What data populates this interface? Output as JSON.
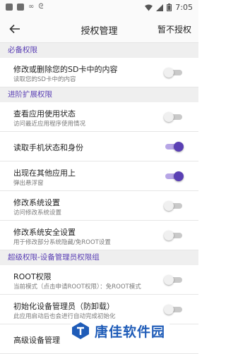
{
  "status_bar": {
    "time": "7:05"
  },
  "app_bar": {
    "title": "授权管理",
    "action_label": "暂不授权"
  },
  "sections": [
    {
      "header": "必备权限",
      "items": [
        {
          "title": "修改或删除您的SD卡中的内容",
          "subtitle": "读取您的SD卡中的内容",
          "enabled": false
        }
      ]
    },
    {
      "header": "进阶扩展权限",
      "items": [
        {
          "title": "查看应用使用状态",
          "subtitle": "访问最近应用程序使用情况",
          "enabled": false
        },
        {
          "title": "读取手机状态和身份",
          "subtitle": "",
          "enabled": true
        },
        {
          "title": "出现在其他应用上",
          "subtitle": "弹出悬浮窗",
          "enabled": true
        },
        {
          "title": "修改系统设置",
          "subtitle": "访问修改系统设置",
          "enabled": false
        },
        {
          "title": "修改系统安全设置",
          "subtitle": "用于修改部分系统隐藏/免ROOT设置",
          "enabled": false
        }
      ]
    },
    {
      "header": "超级权限-设备管理员权限组",
      "items": [
        {
          "title": "ROOT权限",
          "subtitle": "当前模式（点击申请ROOT权限）：免ROOT模式",
          "enabled": false
        },
        {
          "title": "初始化设备管理员（防卸载）",
          "subtitle": "此应用启动后也会进行自动完成初始化",
          "enabled": false
        },
        {
          "title": "高级设备管理",
          "subtitle": "",
          "enabled": false
        }
      ]
    }
  ],
  "watermark": {
    "text": "唐佳软件园"
  },
  "colors": {
    "accent": "#5a3fb4",
    "track_on": "#b7a6e6",
    "track_off": "#c9c9c9"
  }
}
